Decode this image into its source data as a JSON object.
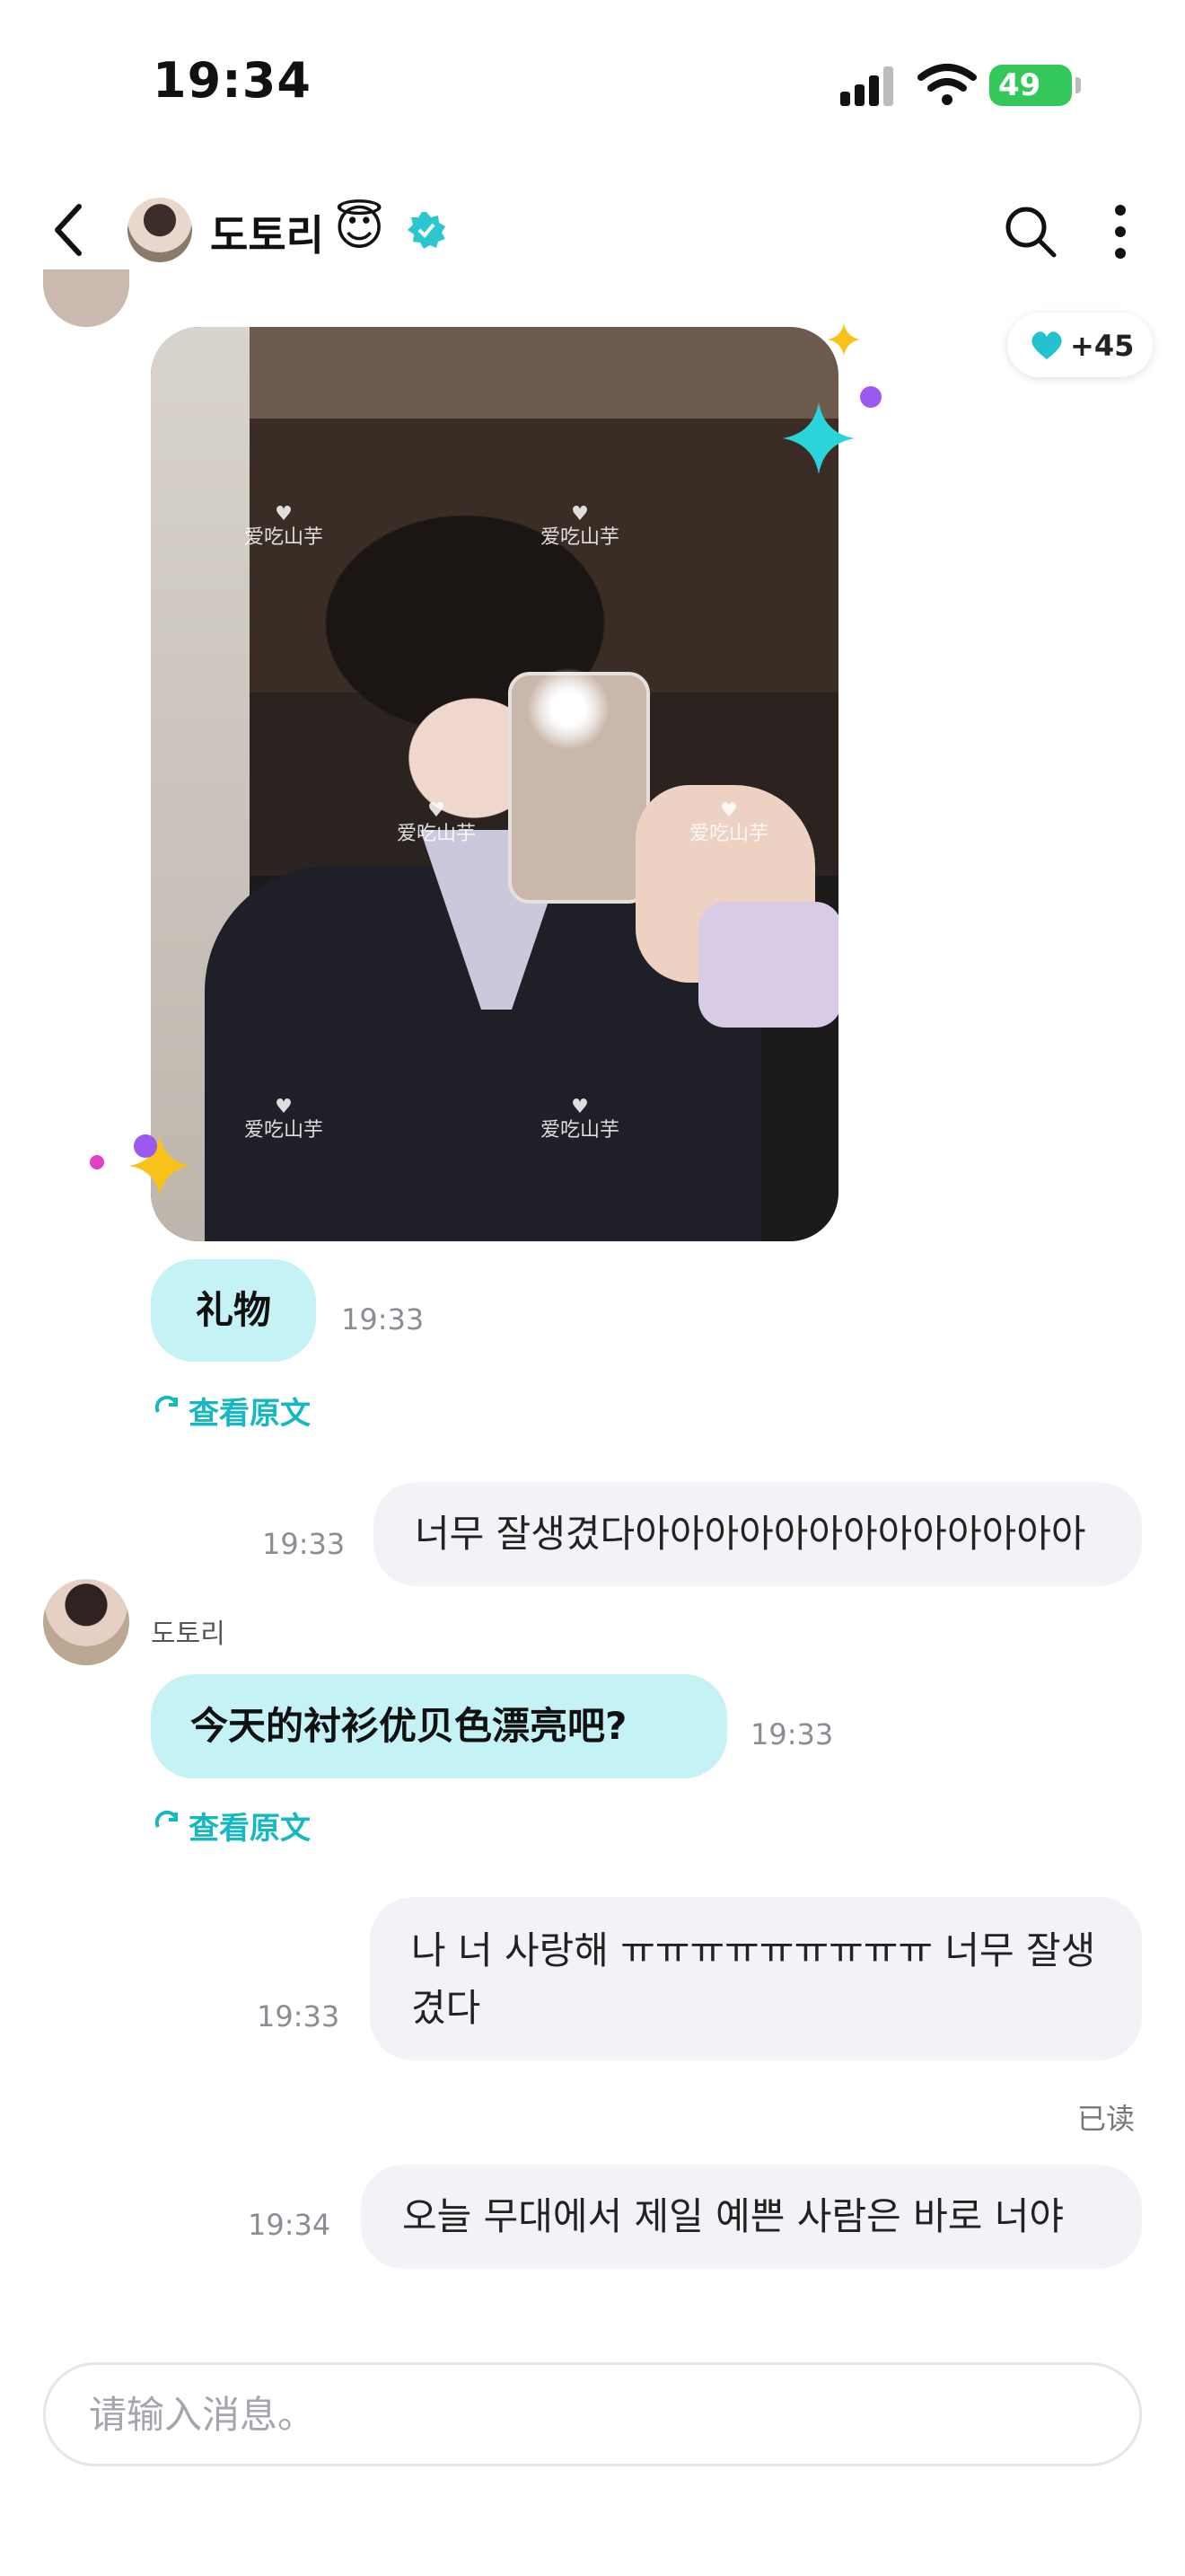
{
  "status_bar": {
    "time": "19:34",
    "battery": "49"
  },
  "header": {
    "name": "도토리",
    "emoji": "😇"
  },
  "heart_pill": {
    "count": "+45"
  },
  "photo": {
    "watermark": "爱吃山芋"
  },
  "messages": [
    {
      "text": "礼物",
      "time": "19:33",
      "view_original": "查看原文"
    },
    {
      "text": "너무 잘생겼다아아아아아아아아아아아아아",
      "time": "19:33"
    },
    {
      "sender": "도토리",
      "text": "今天的衬衫优贝色漂亮吧?",
      "time": "19:33",
      "view_original": "查看原文"
    },
    {
      "text": "나 너 사랑해 ㅠㅠㅠㅠㅠㅠㅠㅠㅠ 너무 잘생겼다",
      "time": "19:33",
      "read": "已读"
    },
    {
      "text": "오늘 무대에서 제일 예쁜 사람은 바로 너야",
      "time": "19:34"
    }
  ],
  "input": {
    "placeholder": "请输入消息。"
  },
  "colors": {
    "accent": "#14b8c0",
    "incoming_bubble": "#c4f2f5",
    "outgoing_bubble": "#f2f3f7"
  }
}
